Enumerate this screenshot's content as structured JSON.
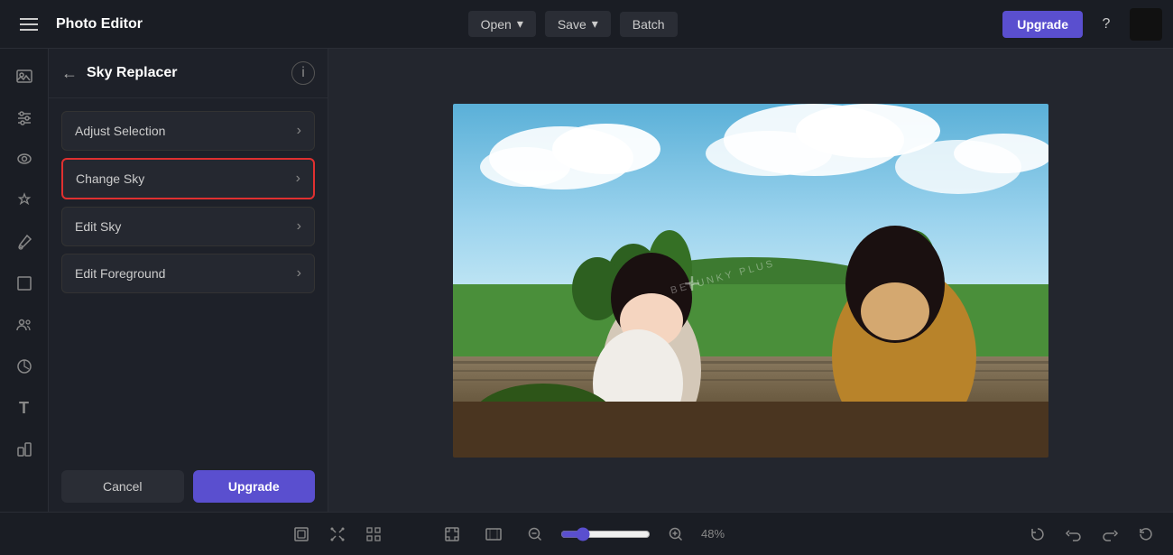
{
  "topbar": {
    "app_title": "Photo Editor",
    "open_label": "Open",
    "save_label": "Save",
    "batch_label": "Batch",
    "upgrade_label": "Upgrade"
  },
  "panel": {
    "title": "Sky Replacer",
    "items": [
      {
        "id": "adjust-selection",
        "label": "Adjust Selection",
        "active": false
      },
      {
        "id": "change-sky",
        "label": "Change Sky",
        "active": true
      },
      {
        "id": "edit-sky",
        "label": "Edit Sky",
        "active": false
      },
      {
        "id": "edit-foreground",
        "label": "Edit Foreground",
        "active": false
      }
    ],
    "cancel_label": "Cancel",
    "upgrade_label": "Upgrade"
  },
  "bottom": {
    "zoom_value": "48",
    "zoom_unit": "%"
  },
  "sidebar": {
    "icons": [
      {
        "name": "photos-icon",
        "symbol": "🖼"
      },
      {
        "name": "adjustments-icon",
        "symbol": "⚙"
      },
      {
        "name": "eye-icon",
        "symbol": "👁"
      },
      {
        "name": "effects-icon",
        "symbol": "✨"
      },
      {
        "name": "brush-icon",
        "symbol": "🖌"
      },
      {
        "name": "layers-icon",
        "symbol": "□"
      },
      {
        "name": "people-icon",
        "symbol": "👥"
      },
      {
        "name": "stickers-icon",
        "symbol": "◉"
      },
      {
        "name": "text-icon",
        "symbol": "T"
      },
      {
        "name": "graphics-icon",
        "symbol": "◈"
      }
    ]
  }
}
